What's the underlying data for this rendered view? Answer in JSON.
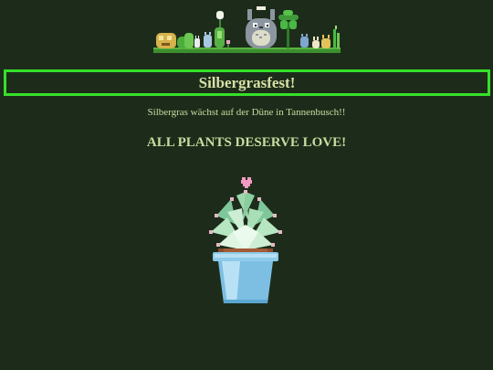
{
  "page": {
    "title": "Silbergrasfest!",
    "subtitle": "Silbergras wächst auf der Düne in Tannenbusch!!",
    "slogan": "ALL PLANTS DESERVE LOVE!"
  },
  "images": {
    "banner": "pixel-art-plants-and-totoro-banner",
    "plant": "pixel-art-succulent-in-blue-pot-with-heart"
  },
  "colors": {
    "background": "#1d2c1a",
    "border": "#35e12a",
    "text": "#c7dca0"
  }
}
